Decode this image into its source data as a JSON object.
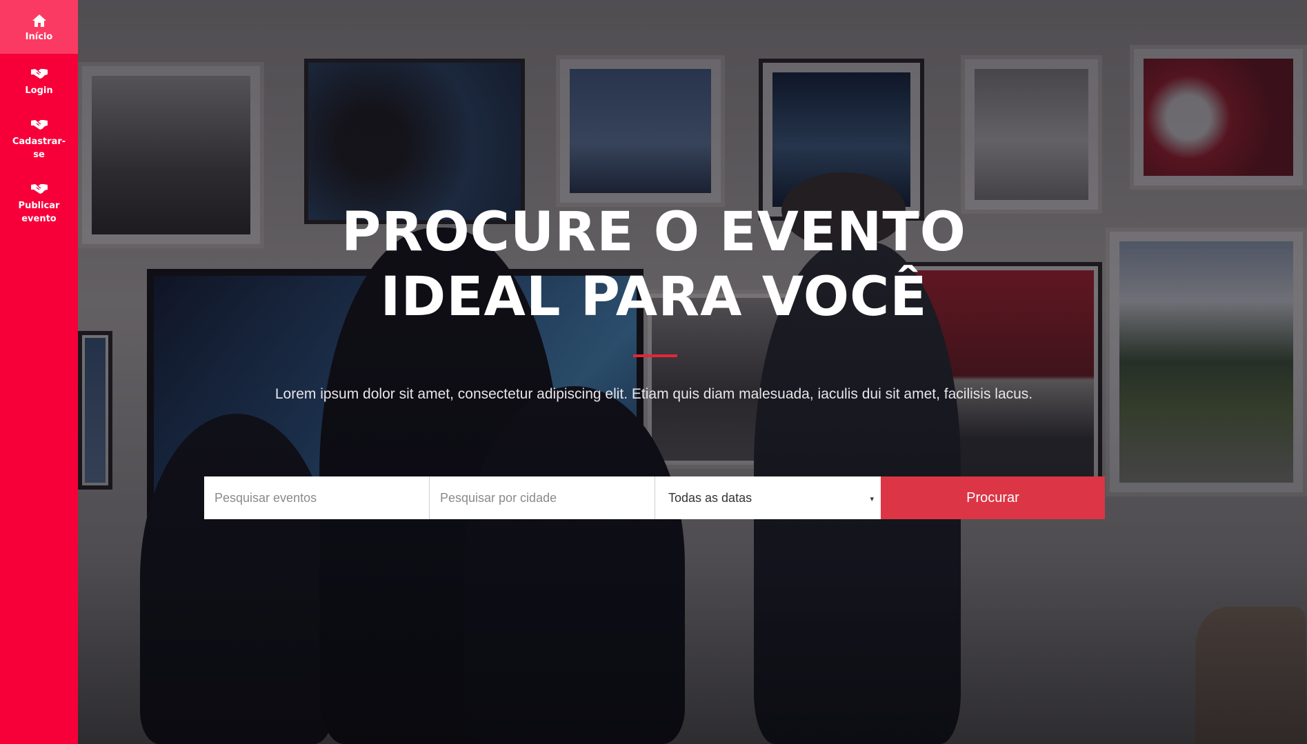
{
  "sidebar": {
    "items": [
      {
        "label": "Início",
        "icon": "home-icon",
        "active": true
      },
      {
        "label": "Login",
        "icon": "handshake-icon"
      },
      {
        "label": "Cadastrar-se",
        "icon": "handshake-icon"
      },
      {
        "label": "Publicar evento",
        "icon": "handshake-icon"
      }
    ]
  },
  "hero": {
    "headline": "PROCURE O EVENTO IDEAL PARA VOCÊ",
    "subtitle": "Lorem ipsum dolor sit amet, consectetur adipiscing elit. Etiam quis diam malesuada, iaculis dui sit amet, facilisis lacus."
  },
  "search": {
    "events_placeholder": "Pesquisar eventos",
    "city_placeholder": "Pesquisar por cidade",
    "date_selected": "Todas as datas",
    "caret": "▾",
    "button_label": "Procurar"
  },
  "colors": {
    "sidebar": "#f7003a",
    "sidebar_active": "#fb3a63",
    "button": "#dc3545",
    "divider": "#e8243a"
  }
}
